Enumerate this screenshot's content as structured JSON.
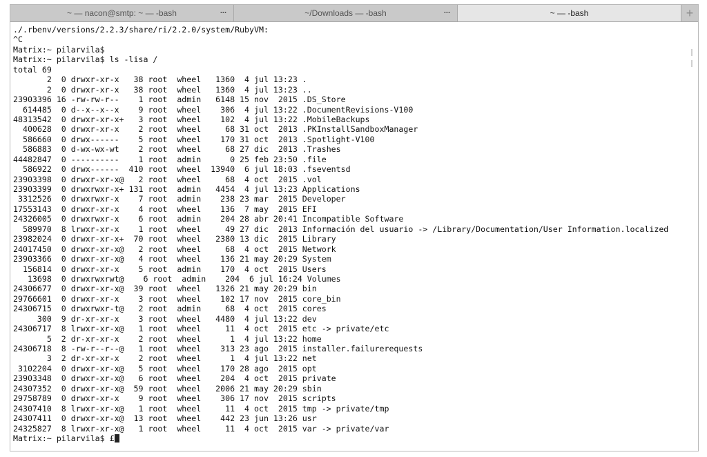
{
  "tabs": [
    {
      "label": "~ — nacon@smtp: ~ — -bash",
      "more": "...",
      "active": false
    },
    {
      "label": "~/Downloads — -bash",
      "more": "...",
      "active": false
    },
    {
      "label": "~ — -bash",
      "more": "",
      "active": true
    }
  ],
  "new_tab_label": "+",
  "terminal": {
    "lines": [
      "./.rbenv/versions/2.2.3/share/ri/2.2.0/system/RubyVM:",
      "^C",
      "Matrix:~ pilarvila$",
      "Matrix:~ pilarvila$ ls -lisa /",
      "total 69",
      "       2  0 drwxr-xr-x   38 root  wheel   1360  4 jul 13:23 .",
      "       2  0 drwxr-xr-x   38 root  wheel   1360  4 jul 13:23 ..",
      "23903396 16 -rw-rw-r--    1 root  admin   6148 15 nov  2015 .DS_Store",
      "  614485  0 d--x--x--x    9 root  wheel    306  4 jul 13:22 .DocumentRevisions-V100",
      "48313542  0 drwxr-xr-x+   3 root  wheel    102  4 jul 13:22 .MobileBackups",
      "  400628  0 drwxr-xr-x    2 root  wheel     68 31 oct  2013 .PKInstallSandboxManager",
      "  586660  0 drwx------    5 root  wheel    170 31 oct  2013 .Spotlight-V100",
      "  586883  0 d-wx-wx-wt    2 root  wheel     68 27 dic  2013 .Trashes",
      "44482847  0 ----------    1 root  admin      0 25 feb 23:50 .file",
      "  586922  0 drwx------  410 root  wheel  13940  6 jul 18:03 .fseventsd",
      "23903398  0 drwxr-xr-x@   2 root  wheel     68  4 oct  2015 .vol",
      "23903399  0 drwxrwxr-x+ 131 root  admin   4454  4 jul 13:23 Applications",
      " 3312526  0 drwxrwxr-x    7 root  admin    238 23 mar  2015 Developer",
      "17553143  0 drwxr-xr-x    4 root  wheel    136  7 may  2015 EFI",
      "24326005  0 drwxrwxr-x    6 root  admin    204 28 abr 20:41 Incompatible Software",
      "  589970  8 lrwxr-xr-x    1 root  wheel     49 27 dic  2013 Información del usuario -> /Library/Documentation/User Information.localized",
      "23982024  0 drwxr-xr-x+  70 root  wheel   2380 13 dic  2015 Library",
      "24017450  0 drwxr-xr-x@   2 root  wheel     68  4 oct  2015 Network",
      "23903366  0 drwxr-xr-x@   4 root  wheel    136 21 may 20:29 System",
      "  156814  0 drwxr-xr-x    5 root  admin    170  4 oct  2015 Users",
      "   13698  0 drwxrwxrwt@    6 root  admin    204  6 jul 16:24 Volumes",
      "24306677  0 drwxr-xr-x@  39 root  wheel   1326 21 may 20:29 bin",
      "29766601  0 drwxr-xr-x    3 root  wheel    102 17 nov  2015 core_bin",
      "24306715  0 drwxrwxr-t@   2 root  admin     68  4 oct  2015 cores",
      "     300  9 dr-xr-xr-x    3 root  wheel   4480  4 jul 13:22 dev",
      "24306717  8 lrwxr-xr-x@   1 root  wheel     11  4 oct  2015 etc -> private/etc",
      "       5  2 dr-xr-xr-x    2 root  wheel      1  4 jul 13:22 home",
      "24306718  8 -rw-r--r--@   1 root  wheel    313 23 ago  2015 installer.failurerequests",
      "       3  2 dr-xr-xr-x    2 root  wheel      1  4 jul 13:22 net",
      " 3102204  0 drwxr-xr-x@   5 root  wheel    170 28 ago  2015 opt",
      "23903348  0 drwxr-xr-x@   6 root  wheel    204  4 oct  2015 private",
      "24307352  0 drwxr-xr-x@  59 root  wheel   2006 21 may 20:29 sbin",
      "29758789  0 drwxr-xr-x    9 root  wheel    306 17 nov  2015 scripts",
      "24307410  8 lrwxr-xr-x@   1 root  wheel     11  4 oct  2015 tmp -> private/tmp",
      "24307411  0 drwxr-xr-x@  13 root  wheel    442 23 jun 13:26 usr",
      "24325827  8 lrwxr-xr-x@   1 root  wheel     11  4 oct  2015 var -> private/var"
    ],
    "prompt": "Matrix:~ pilarvila$ £"
  }
}
